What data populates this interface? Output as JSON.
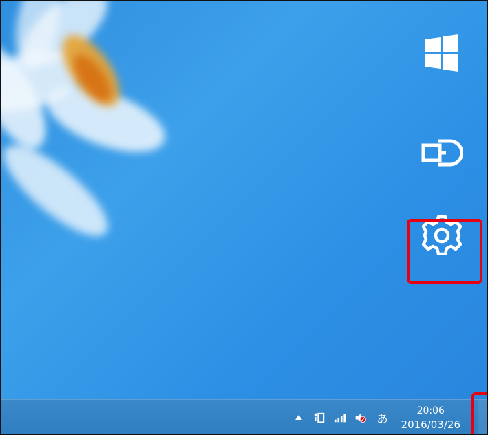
{
  "desktop": {
    "wallpaper": "blurred-white-flower"
  },
  "charms": {
    "items": [
      {
        "name": "start",
        "icon": "windows-logo-icon"
      },
      {
        "name": "devices",
        "icon": "devices-icon"
      },
      {
        "name": "settings",
        "icon": "gear-icon",
        "highlighted": true
      }
    ]
  },
  "taskbar": {
    "tray": {
      "show_hidden_icons": "caret-up-icon",
      "network_icon": "network-icon",
      "signal_icon": "signal-bars-icon",
      "volume_icon": "volume-muted-icon",
      "ime_label": "あ"
    },
    "clock": {
      "time": "20:06",
      "date": "2016/03/26"
    }
  },
  "colors": {
    "highlight": "#e60012",
    "taskbar": "#2f7ec0",
    "desktop": "#2c8fe4"
  }
}
